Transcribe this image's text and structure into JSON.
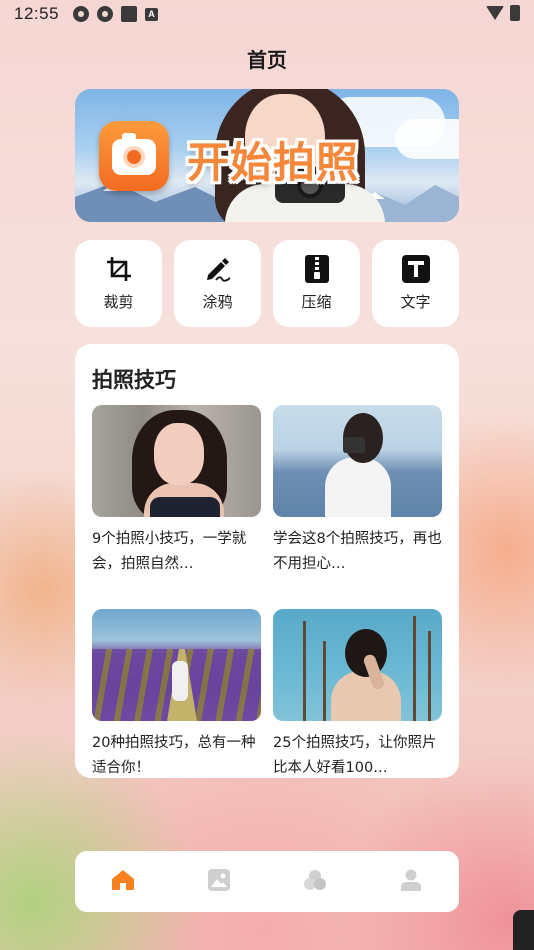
{
  "status_bar": {
    "time": "12:55",
    "icons": [
      "flower-icon",
      "flower-icon",
      "square-icon",
      "a-badge-icon"
    ],
    "right_icons": [
      "wifi-icon",
      "battery-charging-icon"
    ],
    "a_badge": "A"
  },
  "header": {
    "title": "首页"
  },
  "banner": {
    "text": "开始拍照",
    "app_icon": "camera-app-icon"
  },
  "tools": [
    {
      "label": "裁剪",
      "icon": "crop-icon"
    },
    {
      "label": "涂鸦",
      "icon": "pen-scribble-icon"
    },
    {
      "label": "压缩",
      "icon": "zip-compress-icon"
    },
    {
      "label": "文字",
      "icon": "text-t-icon"
    }
  ],
  "tips": {
    "title": "拍照技巧",
    "cards": [
      {
        "text": "9个拍照小技巧，一学就会，拍照自然…"
      },
      {
        "text": "学会这8个拍照技巧，再也不用担心…"
      },
      {
        "text": "20种拍照技巧，总有一种适合你！"
      },
      {
        "text": "25个拍照技巧，让你照片比本人好看100…"
      }
    ]
  },
  "tabbar": {
    "items": [
      {
        "icon": "home-icon",
        "active": true
      },
      {
        "icon": "gallery-icon",
        "active": false
      },
      {
        "icon": "circles-filter-icon",
        "active": false
      },
      {
        "icon": "person-icon",
        "active": false
      }
    ],
    "active_color": "#f5821f",
    "inactive_color": "#cfcfcf"
  },
  "colors": {
    "accent": "#f5821f",
    "card_bg": "#ffffff",
    "text": "#222222"
  }
}
